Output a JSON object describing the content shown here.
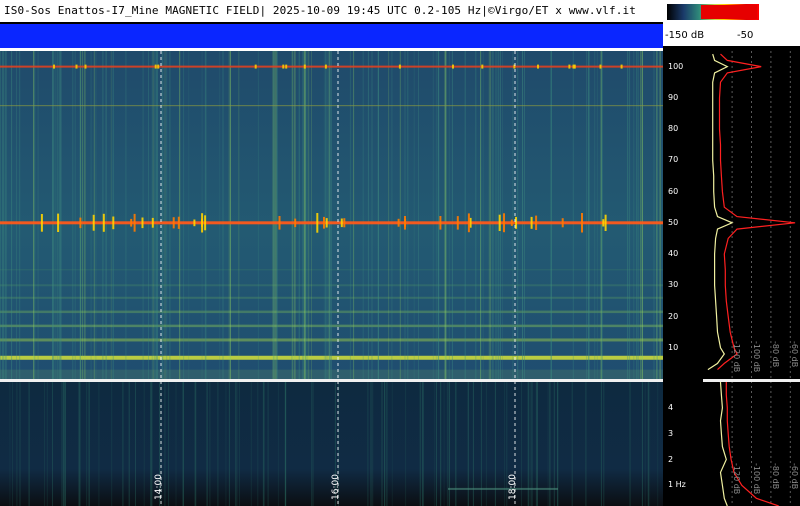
{
  "header": {
    "title": "IS0-Sos Enattos-I7_Mine MAGNETIC FIELD| 2025-10-09 19:45 UTC 0.2-105 Hz|©Virgo/ET x www.vlf.it"
  },
  "colorbar": {
    "min_label": "-150 dB",
    "max_label": "-50",
    "colors": [
      "#000000",
      "#1a3a6a",
      "#2f8a7a",
      "#c8d84a",
      "#ffd000",
      "#ff6000",
      "#e00000"
    ]
  },
  "chart_data": [
    {
      "type": "heatmap",
      "panel": "upper",
      "yticks": [
        10,
        20,
        30,
        40,
        50,
        60,
        70,
        80,
        90,
        100
      ],
      "ylim": [
        0,
        105
      ],
      "time_ticks": [
        "14:00",
        "16:00",
        "18:00"
      ],
      "lines_hz": [
        50,
        100
      ],
      "series": [
        {
          "name": "",
          "color": "#ff2020",
          "x": [
            3,
            5,
            8,
            10,
            15,
            20,
            25,
            30,
            35,
            40,
            45,
            48,
            50,
            52,
            55,
            60,
            65,
            70,
            75,
            80,
            85,
            90,
            95,
            98,
            100,
            102,
            104
          ],
          "y": [
            -135,
            -128,
            -115,
            -118,
            -122,
            -124,
            -126,
            -127,
            -127,
            -128,
            -124,
            -115,
            -55,
            -115,
            -128,
            -130,
            -131,
            -132,
            -132,
            -133,
            -133,
            -133,
            -132,
            -125,
            -90,
            -125,
            -132
          ]
        },
        {
          "name": "",
          "color": "#f0f0a0",
          "x": [
            3,
            5,
            8,
            10,
            15,
            20,
            25,
            30,
            35,
            40,
            45,
            48,
            50,
            52,
            55,
            60,
            65,
            70,
            75,
            80,
            85,
            90,
            95,
            98,
            100,
            102,
            104
          ],
          "y": [
            -145,
            -135,
            -128,
            -132,
            -135,
            -136,
            -137,
            -138,
            -138,
            -138,
            -137,
            -135,
            -120,
            -135,
            -138,
            -139,
            -139,
            -140,
            -140,
            -140,
            -140,
            -140,
            -140,
            -138,
            -125,
            -138,
            -140
          ]
        }
      ],
      "db_labels": [
        "-120 dB",
        "-100 dB",
        "-80 dB",
        "-60 dB"
      ]
    },
    {
      "type": "heatmap",
      "panel": "lower",
      "yticks": [
        1,
        2,
        3,
        4
      ],
      "ytick_labels": [
        "1 Hz",
        "2",
        "3",
        "4"
      ],
      "ylim": [
        0.2,
        5
      ],
      "time_ticks": [
        "14:00",
        "16:00",
        "18:00"
      ],
      "series": [
        {
          "name": "",
          "color": "#ff2020",
          "x": [
            0.2,
            0.5,
            1,
            1.5,
            2,
            2.5,
            3,
            3.5,
            4,
            4.5,
            5
          ],
          "y": [
            -72,
            -95,
            -110,
            -118,
            -121,
            -123,
            -124,
            -125,
            -125,
            -126,
            -126
          ]
        },
        {
          "name": "",
          "color": "#f0f0a0",
          "x": [
            0.2,
            0.5,
            1,
            1.5,
            2,
            2.5,
            3,
            3.5,
            4,
            4.5,
            5
          ],
          "y": [
            -125,
            -128,
            -130,
            -132,
            -126,
            -130,
            -131,
            -132,
            -130,
            -131,
            -132
          ]
        }
      ],
      "db_labels": [
        "-120 dB",
        "-100 dB",
        "-80 dB",
        "-60 dB"
      ]
    }
  ]
}
